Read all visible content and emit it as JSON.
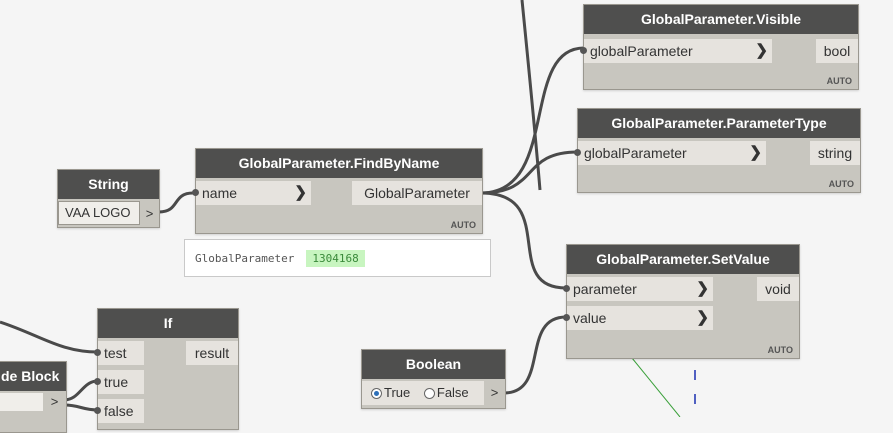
{
  "nodes": {
    "visible": {
      "title": "GlobalParameter.Visible",
      "input": "globalParameter",
      "output": "bool",
      "lacing": "AUTO"
    },
    "parameter_type": {
      "title": "GlobalParameter.ParameterType",
      "input": "globalParameter",
      "output": "string",
      "lacing": "AUTO"
    },
    "find_by_name": {
      "title": "GlobalParameter.FindByName",
      "input": "name",
      "output": "GlobalParameter",
      "lacing": "AUTO",
      "preview_label": "GlobalParameter",
      "preview_value": "1304168"
    },
    "string": {
      "title": "String",
      "value": "VAA LOGO",
      "output": ">"
    },
    "set_value": {
      "title": "GlobalParameter.SetValue",
      "input_parameter": "parameter",
      "input_value": "value",
      "output": "void",
      "lacing": "AUTO"
    },
    "boolean": {
      "title": "Boolean",
      "option_true": "True",
      "option_false": "False",
      "selected": "True",
      "output": ">"
    },
    "if_node": {
      "title": "If",
      "input_test": "test",
      "input_true": "true",
      "input_false": "false",
      "output": "result"
    },
    "code_block": {
      "title": "de Block",
      "output": ">"
    }
  },
  "colors": {
    "node_header": "#4f4f4e",
    "node_body": "#c8c6bf",
    "port_bg": "#e6e3de",
    "wire": "#4a4a4a",
    "preview_value_bg": "#c8f5c0",
    "radio_selected": "#2d6fb8"
  }
}
